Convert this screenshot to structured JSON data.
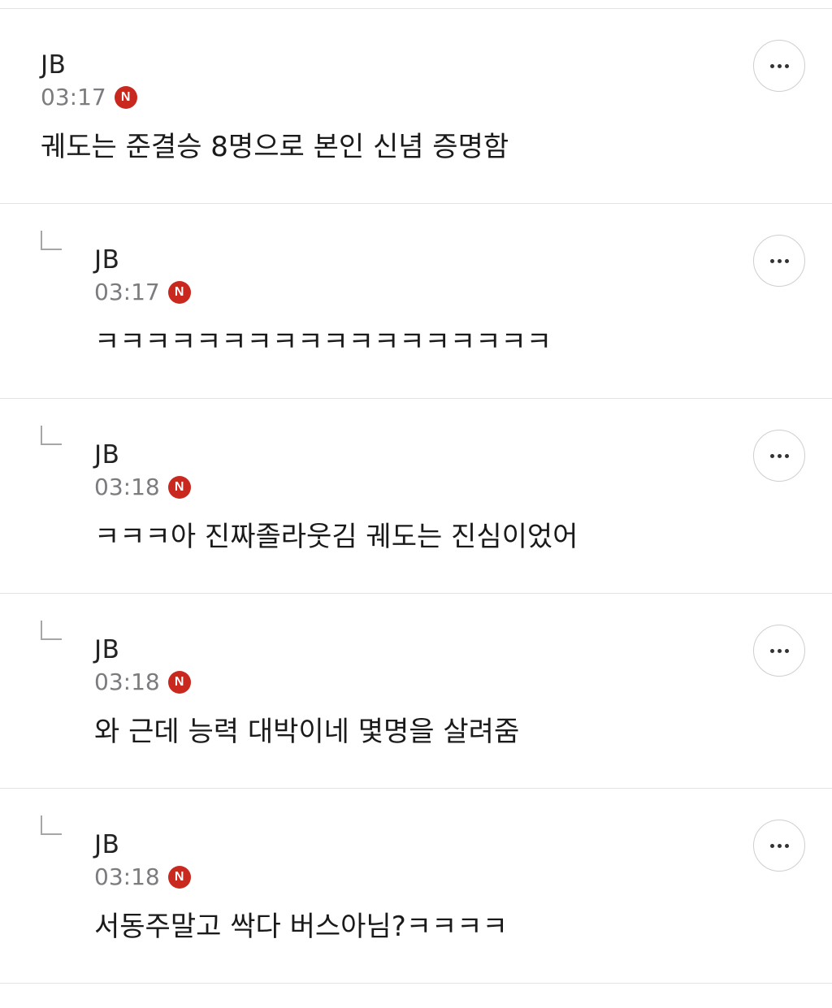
{
  "comments": [
    {
      "author": "JB",
      "time": "03:17",
      "badge": "N",
      "text": "궤도는 준결승 8명으로 본인 신념 증명함",
      "is_reply": false,
      "more_icon": "more-dots-icon"
    },
    {
      "author": "JB",
      "time": "03:17",
      "badge": "N",
      "text": "ㅋㅋㅋㅋㅋㅋㅋㅋㅋㅋㅋㅋㅋㅋㅋㅋㅋㅋ",
      "is_reply": true,
      "more_icon": "more-dots-icon"
    },
    {
      "author": "JB",
      "time": "03:18",
      "badge": "N",
      "text": "ㅋㅋㅋ아 진짜졸라웃김 궤도는 진심이었어",
      "is_reply": true,
      "more_icon": "more-dots-icon"
    },
    {
      "author": "JB",
      "time": "03:18",
      "badge": "N",
      "text": "와 근데 능력 대박이네 몇명을 살려줌",
      "is_reply": true,
      "more_icon": "more-dots-icon"
    },
    {
      "author": "JB",
      "time": "03:18",
      "badge": "N",
      "text": "서동주말고 싹다 버스아님?ㅋㅋㅋㅋ",
      "is_reply": true,
      "more_icon": "more-dots-icon"
    }
  ],
  "colors": {
    "badge": "#c8281e",
    "time": "#7c7c80",
    "divider": "#e2e2e2"
  }
}
